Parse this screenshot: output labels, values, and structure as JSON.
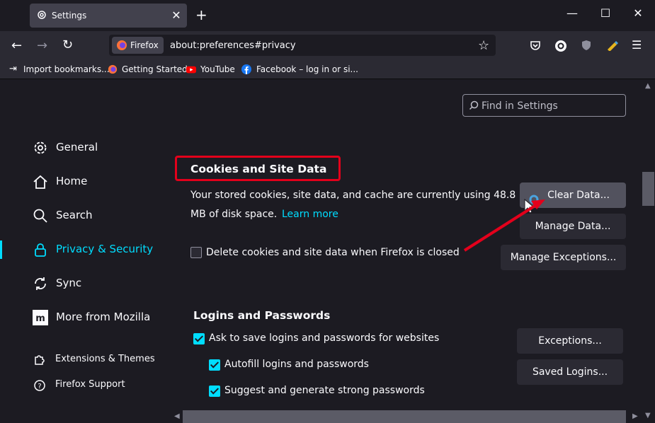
{
  "tab": {
    "title": "Settings",
    "icon": "gear-icon"
  },
  "window": {
    "minimize": "—",
    "maximize": "☐",
    "close": "✕"
  },
  "nav": {
    "identity_label": "Firefox",
    "url": "about:preferences#privacy"
  },
  "bookmarks": [
    {
      "label": "Import bookmarks...",
      "icon": "import-icon"
    },
    {
      "label": "Getting Started",
      "icon": "firefox-icon"
    },
    {
      "label": "YouTube",
      "icon": "youtube-icon"
    },
    {
      "label": "Facebook – log in or si...",
      "icon": "facebook-icon"
    }
  ],
  "search": {
    "placeholder": "Find in Settings"
  },
  "sidebar": {
    "items": [
      {
        "label": "General"
      },
      {
        "label": "Home"
      },
      {
        "label": "Search"
      },
      {
        "label": "Privacy & Security"
      },
      {
        "label": "Sync"
      },
      {
        "label": "More from Mozilla"
      }
    ],
    "footer": [
      {
        "label": "Extensions & Themes"
      },
      {
        "label": "Firefox Support"
      }
    ]
  },
  "cookies": {
    "heading": "Cookies and Site Data",
    "line1": "Your stored cookies, site data, and cache are currently using 48.8",
    "line2": "MB of disk space.",
    "learn_more": "Learn more",
    "delete_label": "Delete cookies and site data when Firefox is closed",
    "clear_btn": "Clear Data...",
    "manage_btn": "Manage Data...",
    "exceptions_btn": "Manage Exceptions..."
  },
  "logins": {
    "heading": "Logins and Passwords",
    "ask_label": "Ask to save logins and passwords for websites",
    "autofill_label": "Autofill logins and passwords",
    "suggest_label": "Suggest and generate strong passwords",
    "exceptions_btn": "Exceptions...",
    "saved_btn": "Saved Logins..."
  },
  "colors": {
    "accent": "#00ddff",
    "annotation": "#e3001b"
  }
}
